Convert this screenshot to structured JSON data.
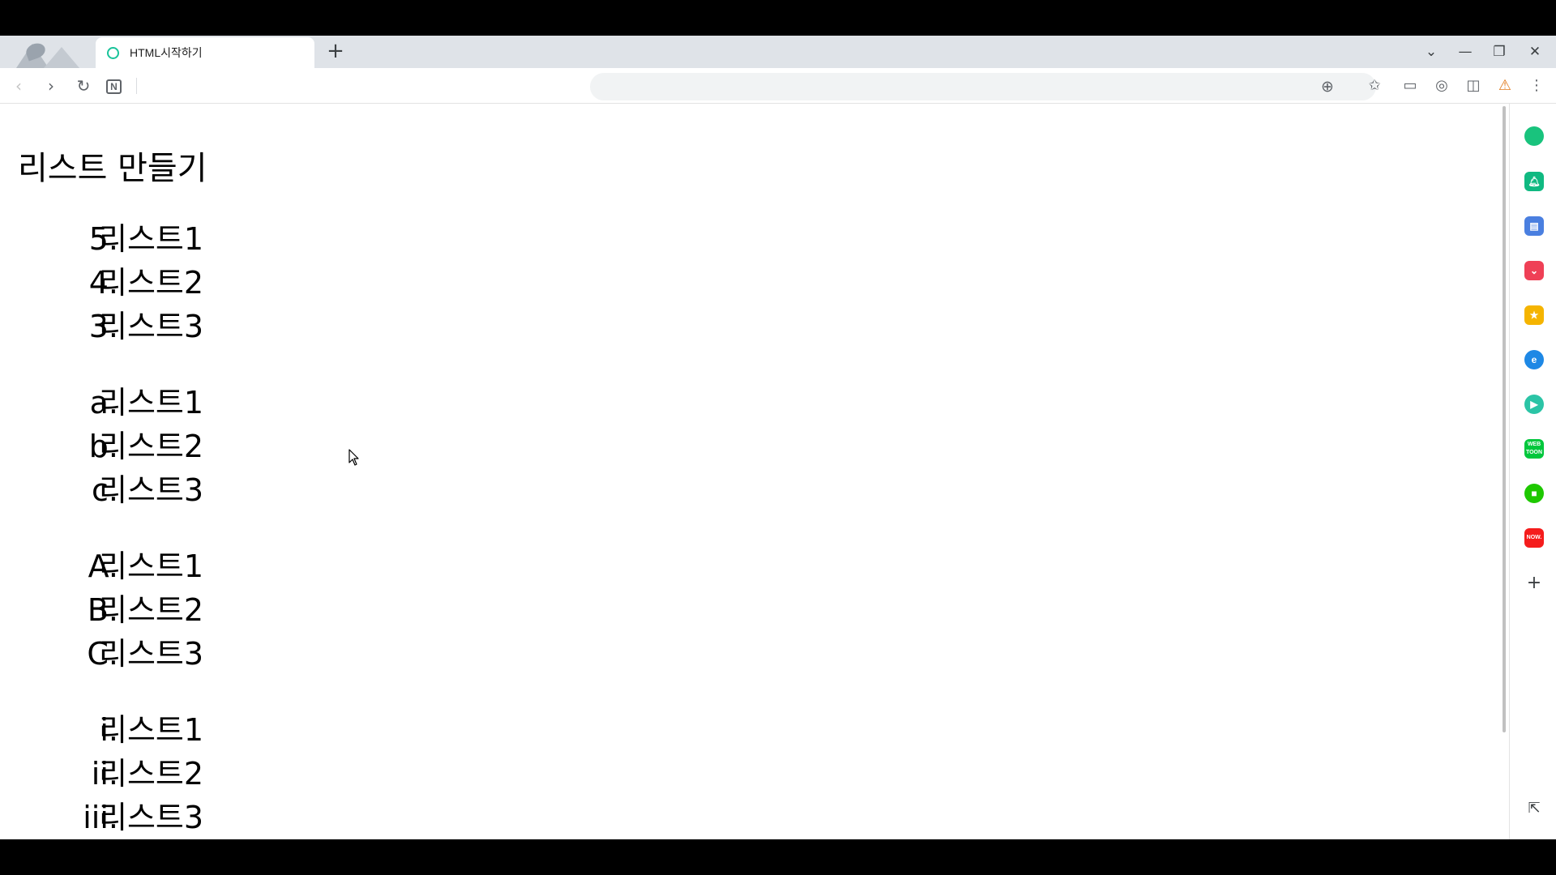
{
  "browser": {
    "tab_title": "HTML시작하기",
    "new_tab_glyph": "+"
  },
  "page": {
    "heading": "리스트 만들기",
    "lists": [
      {
        "items": [
          {
            "marker": "5.",
            "text": "리스트1"
          },
          {
            "marker": "4.",
            "text": "리스트2"
          },
          {
            "marker": "3.",
            "text": "리스트3"
          }
        ]
      },
      {
        "items": [
          {
            "marker": "a.",
            "text": "리스트1"
          },
          {
            "marker": "b.",
            "text": "리스트2"
          },
          {
            "marker": "c.",
            "text": "리스트3"
          }
        ]
      },
      {
        "items": [
          {
            "marker": "A.",
            "text": "리스트1"
          },
          {
            "marker": "B.",
            "text": "리스트2"
          },
          {
            "marker": "C.",
            "text": "리스트3"
          }
        ]
      },
      {
        "items": [
          {
            "marker": "i.",
            "text": "리스트1"
          },
          {
            "marker": "ii.",
            "text": "리스트2"
          },
          {
            "marker": "iii.",
            "text": "리스트3"
          }
        ]
      }
    ]
  },
  "sidebar": {
    "icons": [
      {
        "name": "naver-green-circle-icon",
        "color": "#19c37d"
      },
      {
        "name": "bell-app-icon",
        "color": "#10b981"
      },
      {
        "name": "briefcase-app-icon",
        "color": "#4a7fe0"
      },
      {
        "name": "pocket-app-icon",
        "color": "#ef4056"
      },
      {
        "name": "star-app-icon",
        "color": "#f5b400"
      },
      {
        "name": "edge-app-icon",
        "color": "#1e88e5"
      },
      {
        "name": "play-app-icon",
        "color": "#2bc4a6"
      },
      {
        "name": "webtoon-app-icon",
        "color": "#00c73c",
        "label": "WEB TOON"
      },
      {
        "name": "square-app-icon",
        "color": "#1ec800"
      },
      {
        "name": "now-app-icon",
        "color": "#f51c1c",
        "label": "NOW."
      }
    ]
  }
}
